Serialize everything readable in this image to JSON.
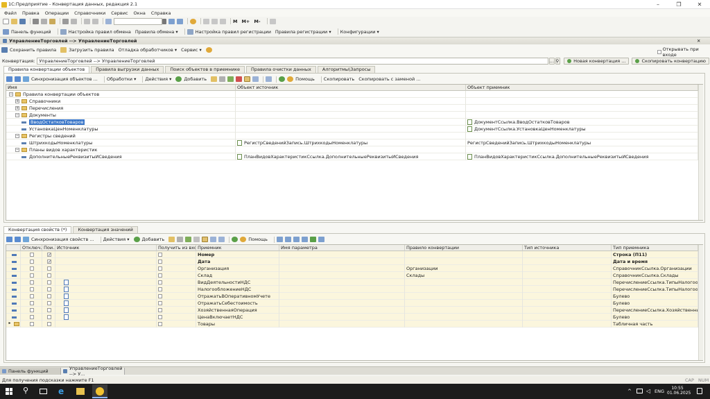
{
  "window": {
    "title": "1С:Предприятие - Конвертация данных, редакция 2.1",
    "min": "–",
    "max": "❐",
    "close": "✕"
  },
  "menu": [
    "Файл",
    "Правка",
    "Операции",
    "Справочники",
    "Сервис",
    "Окна",
    "Справка"
  ],
  "toolbar2": {
    "search_value": "",
    "m1": "M",
    "m2": "M+",
    "m3": "M-"
  },
  "toolbar3": [
    "Панель функций",
    "Настройка правил обмена",
    "Правила обмена ▾",
    "Настройка правил регистрации",
    "Правила регистрации ▾",
    "Конфигурации ▾"
  ],
  "doc": {
    "title": "УправлениеТорговлей --> УправлениеТорговлей",
    "actions": [
      "Сохранить правила",
      "Загрузить правила",
      "Отладка обработчиков ▾",
      "Сервис ▾"
    ],
    "open_on_start": "Открывать при входе",
    "conversion_label": "Конвертация:",
    "conversion_value": "УправлениеТорговлей --> УправлениеТорговлей",
    "new_conv": "Новая конвертация ...",
    "copy_conv": "Скопировать конвертацию",
    "tabs": [
      "Правила конвертации объектов",
      "Правила выгрузки данных",
      "Поиск объектов в приемнике",
      "Правила очистки данных",
      "Алгоритмы\\Запросы"
    ],
    "top_toolbar": [
      "Синхронизация объектов ...",
      "Обработки ▾",
      "Действия ▾",
      "Добавить",
      "Помощь",
      "Скопировать",
      "Скопировать с заменой ..."
    ],
    "top_columns": [
      "Имя",
      "Объект источник",
      "Объект приемник"
    ],
    "top_rows": [
      {
        "lvl": 0,
        "kind": "folder-open",
        "name": "Правила конвертации объектов",
        "src": "",
        "dst": "",
        "src_icon": false,
        "dst_icon": false
      },
      {
        "lvl": 1,
        "kind": "folder-plus",
        "name": "Справочники",
        "src": "",
        "dst": "",
        "src_icon": false,
        "dst_icon": false
      },
      {
        "lvl": 1,
        "kind": "folder-plus",
        "name": "Перечисления",
        "src": "",
        "dst": "",
        "src_icon": false,
        "dst_icon": false
      },
      {
        "lvl": 1,
        "kind": "folder-open",
        "name": "Документы",
        "src": "",
        "dst": "",
        "src_icon": false,
        "dst_icon": false
      },
      {
        "lvl": 2,
        "kind": "item",
        "name": "ВводОстатковТоваров",
        "selected": true,
        "src": "",
        "dst": "ДокументСсылка.ВводОстатковТоваров",
        "src_icon": false,
        "dst_icon": true
      },
      {
        "lvl": 2,
        "kind": "item",
        "name": "УстановкаЦенНоменклатуры",
        "src": "",
        "dst": "ДокументСсылка.УстановкаЦенНоменклатуры",
        "src_icon": false,
        "dst_icon": true
      },
      {
        "lvl": 1,
        "kind": "folder-open",
        "name": "Регистры сведений",
        "src": "",
        "dst": "",
        "src_icon": false,
        "dst_icon": false
      },
      {
        "lvl": 2,
        "kind": "item",
        "name": "ШтрихкодыНоменклатуры",
        "src": "РегистрСведенийЗапись.ШтрихкодыНоменклатуры",
        "dst": "РегистрСведенийЗапись.ШтрихкодыНоменклатуры",
        "src_icon": true,
        "dst_icon": false
      },
      {
        "lvl": 1,
        "kind": "folder-open",
        "name": "Планы видов характеристик",
        "src": "",
        "dst": "",
        "src_icon": false,
        "dst_icon": false
      },
      {
        "lvl": 2,
        "kind": "item",
        "name": "ДополнительныеРеквизитыИСведения",
        "src": "ПланВидовХарактеристикСсылка.ДополнительныеРеквизитыИСведения",
        "dst": "ПланВидовХарактеристикСсылка.ДополнительныеРеквизитыИСведения",
        "src_icon": true,
        "dst_icon": true
      }
    ],
    "bottom_tabs": [
      "Конвертация свойств (*)",
      "Конвертация значений"
    ],
    "bottom_toolbar": [
      "Синхронизация свойств ...",
      "Действия ▾",
      "Добавить",
      "Помощь"
    ],
    "bottom_columns": [
      "Отключ...",
      "Пои...",
      "Источник",
      "Получить из входя...",
      "Приемник",
      "Имя параметра",
      "Правило конвертации",
      "Тип источника",
      "Тип приемника"
    ],
    "bottom_rows": [
      {
        "search": true,
        "src_icon": false,
        "dst": "Номер",
        "rule": "",
        "dtype": "Строка (П11)",
        "bold": true,
        "folder": false
      },
      {
        "search": true,
        "src_icon": false,
        "dst": "Дата",
        "rule": "",
        "dtype": "Дата и время",
        "bold": true,
        "folder": false
      },
      {
        "search": false,
        "src_icon": false,
        "dst": "Организация",
        "rule": "Организации",
        "dtype": "СправочникСсылка.Организации",
        "bold": false,
        "folder": false
      },
      {
        "search": false,
        "src_icon": false,
        "dst": "Склад",
        "rule": "Склады",
        "dtype": "СправочникСсылка.Склады",
        "bold": false,
        "folder": false
      },
      {
        "search": false,
        "src_icon": true,
        "dst": "ВидДеятельностиНДС",
        "rule": "",
        "dtype": "ПеречислениеСсылка.ТипыНалогооблож...",
        "bold": false,
        "folder": false
      },
      {
        "search": false,
        "src_icon": true,
        "dst": "НалогообложениеНДС",
        "rule": "",
        "dtype": "ПеречислениеСсылка.ТипыНалогооблож...",
        "bold": false,
        "folder": false
      },
      {
        "search": false,
        "src_icon": true,
        "dst": "ОтражатьВОперативномУчете",
        "rule": "",
        "dtype": "Булево",
        "bold": false,
        "folder": false
      },
      {
        "search": false,
        "src_icon": true,
        "dst": "ОтражатьСебестоимость",
        "rule": "",
        "dtype": "Булево",
        "bold": false,
        "folder": false
      },
      {
        "search": false,
        "src_icon": true,
        "dst": "ХозяйственнаяОперация",
        "rule": "",
        "dtype": "ПеречислениеСсылка.ХозяйственныеОп...",
        "bold": false,
        "folder": false
      },
      {
        "search": false,
        "src_icon": true,
        "dst": "ЦенаВключаетНДС",
        "rule": "",
        "dtype": "Булево",
        "bold": false,
        "folder": false
      },
      {
        "search": false,
        "src_icon": false,
        "dst": "Товары",
        "rule": "",
        "dtype": "Табличная часть",
        "bold": false,
        "folder": true
      }
    ]
  },
  "windows_bar": [
    "Панель функций",
    "УправлениеТорговлей --> У..."
  ],
  "status": {
    "hint": "Для получения подсказки нажмите F1",
    "cap": "CAP",
    "num": "NUM"
  },
  "taskbar": {
    "lang": "ENG",
    "time": "10:55",
    "date": "01.06.2025"
  }
}
